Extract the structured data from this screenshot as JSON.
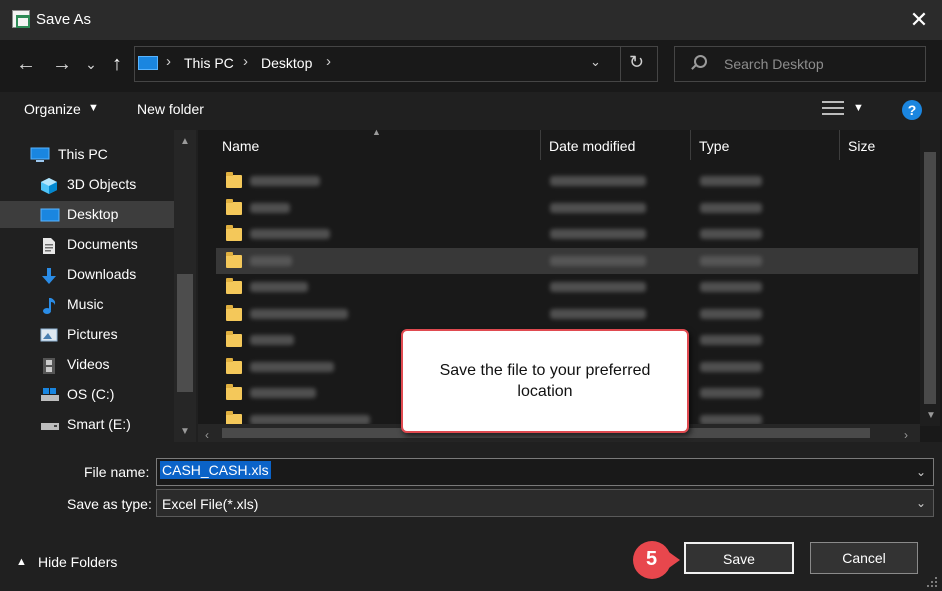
{
  "window": {
    "title": "Save As",
    "close": "✕"
  },
  "nav": {
    "back": "←",
    "forward": "→",
    "recent": "⌄",
    "up": "↑",
    "breadcrumb": [
      "This PC",
      "Desktop"
    ],
    "search_placeholder": "Search Desktop"
  },
  "toolbar": {
    "organize_label": "Organize",
    "new_folder_label": "New folder",
    "help": "?"
  },
  "sidebar": {
    "items": [
      {
        "label": "This PC",
        "icon": "computer-icon"
      },
      {
        "label": "3D Objects",
        "icon": "cube-icon"
      },
      {
        "label": "Desktop",
        "icon": "desktop-icon",
        "selected": true
      },
      {
        "label": "Documents",
        "icon": "documents-icon"
      },
      {
        "label": "Downloads",
        "icon": "download-arrow-icon"
      },
      {
        "label": "Music",
        "icon": "music-note-icon"
      },
      {
        "label": "Pictures",
        "icon": "pictures-icon"
      },
      {
        "label": "Videos",
        "icon": "film-icon"
      },
      {
        "label": "OS (C:)",
        "icon": "drive-icon"
      },
      {
        "label": "Smart (E:)",
        "icon": "drive-icon"
      }
    ]
  },
  "file_list": {
    "columns": [
      "Name",
      "Date modified",
      "Type",
      "Size"
    ],
    "selected_row": 3
  },
  "callout": {
    "text": "Save the file to your preferred location"
  },
  "form": {
    "file_name_label": "File name:",
    "file_name_value": "CASH_CASH.xls",
    "save_type_label": "Save as type:",
    "save_type_value": "Excel File(*.xls)"
  },
  "footer": {
    "hide_folders_label": "Hide Folders",
    "save_label": "Save",
    "cancel_label": "Cancel",
    "step_number": "5"
  },
  "colors": {
    "accent": "#1b86e0",
    "callout_border": "#e04a50",
    "badge": "#e8474d",
    "selection": "#0b63c8"
  }
}
